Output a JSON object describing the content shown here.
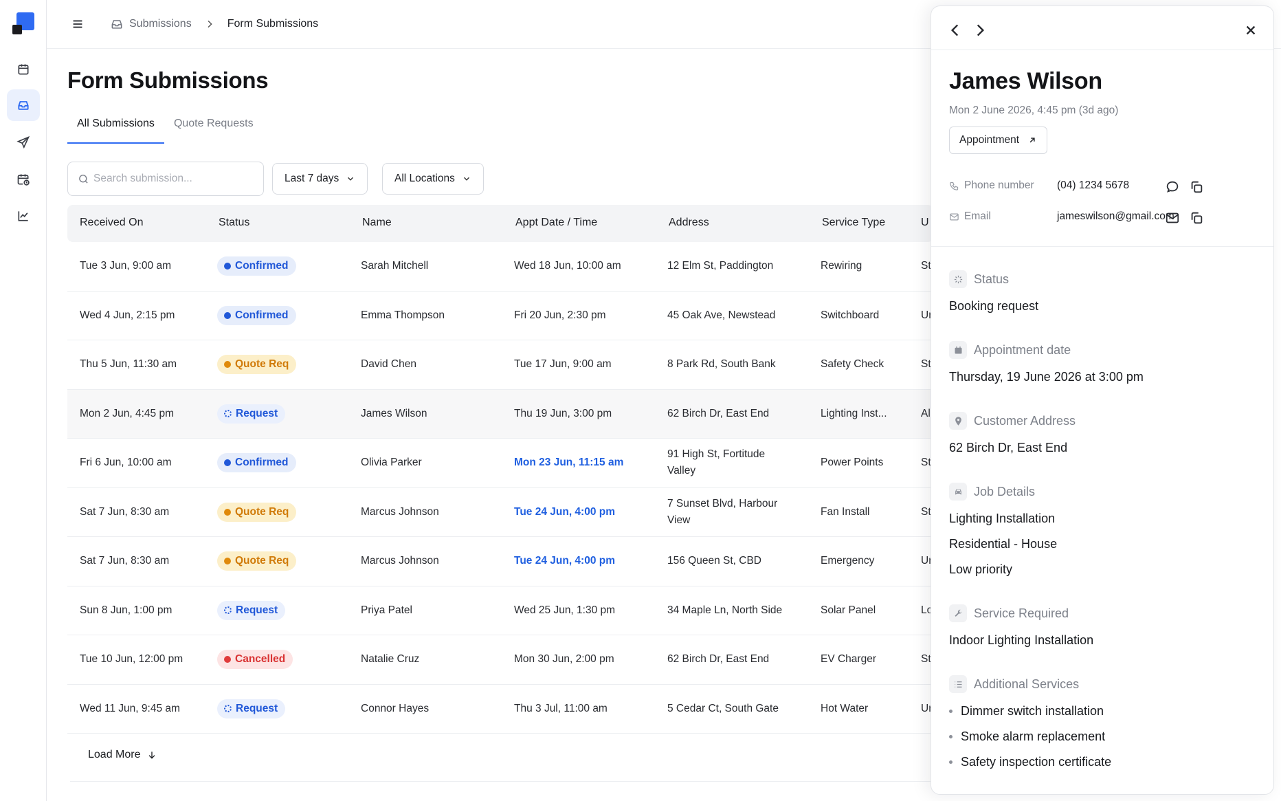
{
  "breadcrumb": {
    "parent": "Submissions",
    "current": "Form Submissions"
  },
  "page": {
    "title": "Form Submissions"
  },
  "tabs": [
    {
      "label": "All Submissions",
      "active": true
    },
    {
      "label": "Quote Requests",
      "active": false
    }
  ],
  "filters": {
    "search_placeholder": "Search submission...",
    "date_range": "Last 7 days",
    "location": "All Locations"
  },
  "table": {
    "columns": [
      "Received On",
      "Status",
      "Name",
      "Appt Date / Time",
      "Address",
      "Service Type",
      "U"
    ],
    "rows": [
      {
        "received": "Tue 3 Jun, 9:00 am",
        "status": "Confirmed",
        "name": "Sarah Mitchell",
        "appt": "Wed 18 Jun, 10:00 am",
        "appt_highlight": false,
        "address": "12 Elm St, Paddington",
        "service": "Rewiring",
        "extra": "St"
      },
      {
        "received": "Wed 4 Jun, 2:15 pm",
        "status": "Confirmed",
        "name": "Emma Thompson",
        "appt": "Fri 20 Jun, 2:30 pm",
        "appt_highlight": false,
        "address": "45 Oak Ave, Newstead",
        "service": "Switchboard",
        "extra": "Ur"
      },
      {
        "received": "Thu 5 Jun, 11:30 am",
        "status": "Quote Req",
        "name": "David Chen",
        "appt": "Tue 17 Jun, 9:00 am",
        "appt_highlight": false,
        "address": "8 Park Rd, South Bank",
        "service": "Safety Check",
        "extra": "St"
      },
      {
        "received": "Mon 2 Jun, 4:45 pm",
        "status": "Request",
        "name": "James Wilson",
        "appt": "Thu 19 Jun, 3:00 pm",
        "appt_highlight": false,
        "address": "62 Birch Dr, East End",
        "service": "Lighting Inst...",
        "extra": "Al"
      },
      {
        "received": "Fri 6 Jun, 10:00 am",
        "status": "Confirmed",
        "name": "Olivia Parker",
        "appt": "Mon 23 Jun, 11:15 am",
        "appt_highlight": true,
        "address": "91 High St, Fortitude Valley",
        "service": "Power Points",
        "extra": "St"
      },
      {
        "received": "Sat 7 Jun, 8:30 am",
        "status": "Quote Req",
        "name": "Marcus Johnson",
        "appt": "Tue 24 Jun, 4:00 pm",
        "appt_highlight": true,
        "address": "7 Sunset Blvd, Harbour View",
        "service": "Fan Install",
        "extra": "St"
      },
      {
        "received": "Sat 7 Jun, 8:30 am",
        "status": "Quote Req",
        "name": "Marcus Johnson",
        "appt": "Tue 24 Jun, 4:00 pm",
        "appt_highlight": true,
        "address": "156 Queen St, CBD",
        "service": "Emergency",
        "extra": "Ur"
      },
      {
        "received": "Sun 8 Jun, 1:00 pm",
        "status": "Request",
        "name": "Priya Patel",
        "appt": "Wed 25 Jun, 1:30 pm",
        "appt_highlight": false,
        "address": "34 Maple Ln, North Side",
        "service": "Solar Panel",
        "extra": "Lo"
      },
      {
        "received": "Tue 10 Jun, 12:00 pm",
        "status": "Cancelled",
        "name": "Natalie Cruz",
        "appt": "Mon 30 Jun, 2:00 pm",
        "appt_highlight": false,
        "address": "62 Birch Dr, East End",
        "service": "EV Charger",
        "extra": "St"
      },
      {
        "received": "Wed 11 Jun, 9:45 am",
        "status": "Request",
        "name": "Connor Hayes",
        "appt": "Thu 3 Jul, 11:00 am",
        "appt_highlight": false,
        "address": "5 Cedar Ct, South Gate",
        "service": "Hot Water",
        "extra": "Ur"
      }
    ],
    "selected_row": 3,
    "load_more": "Load More"
  },
  "detail": {
    "name": "James Wilson",
    "received": "Mon 2 June 2026, 4:45 pm (3d ago)",
    "type_tag": "Appointment",
    "phone_label": "Phone number",
    "phone": "(04) 1234 5678",
    "email_label": "Email",
    "email": "jameswilson@gmail.com",
    "status_label": "Status",
    "status": "Booking request",
    "appt_label": "Appointment date",
    "appt": "Thursday, 19 June 2026 at 3:00 pm",
    "address_label": "Customer Address",
    "address": "62 Birch Dr, East End",
    "job_label": "Job Details",
    "job": [
      "Lighting Installation",
      "Residential - House",
      "Low priority"
    ],
    "service_label": "Service Required",
    "service": "Indoor Lighting Installation",
    "additional_label": "Additional Services",
    "additional": [
      "Dimmer switch installation",
      "Smoke alarm replacement",
      "Safety inspection certificate"
    ]
  },
  "colors": {
    "accent": "#2f6bf2",
    "confirmed": "#2158d8",
    "quote": "#d07a08",
    "cancelled": "#d93333"
  }
}
